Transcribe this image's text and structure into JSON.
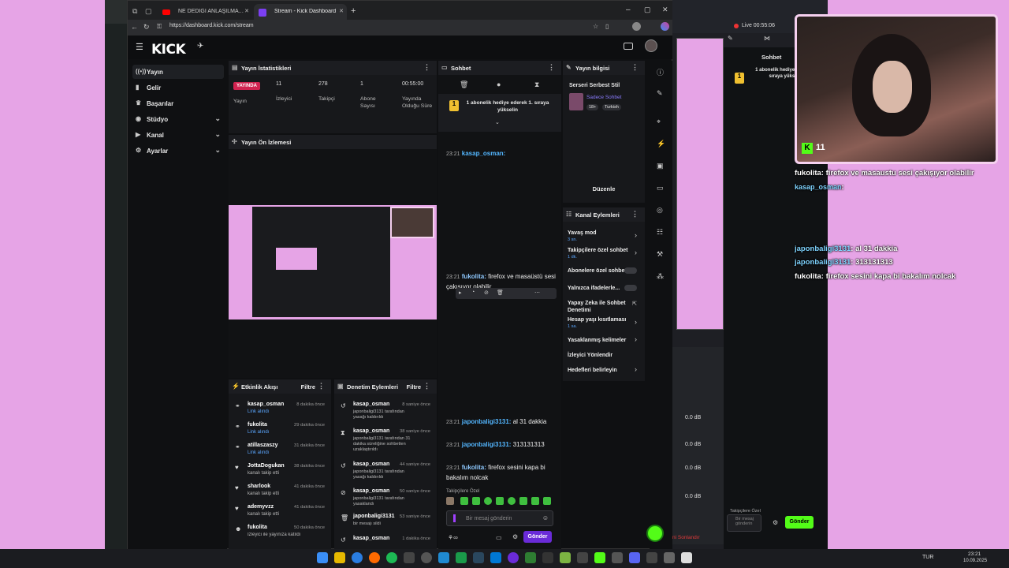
{
  "browser": {
    "tabs": [
      {
        "label": "NE DEDİĞİ ANLAŞILMAYAN KADI"
      },
      {
        "label": "Stream - Kick Dashboard"
      }
    ],
    "url": "https://dashboard.kick.com/stream"
  },
  "kick": {
    "logo": "KICK",
    "nav": [
      {
        "label": "Yayın",
        "icon": "broadcast-icon"
      },
      {
        "label": "Gelir",
        "icon": "revenue-icon"
      },
      {
        "label": "Başarılar",
        "icon": "trophy-icon"
      },
      {
        "label": "Stüdyo",
        "icon": "studio-icon"
      },
      {
        "label": "Kanal",
        "icon": "channel-icon"
      },
      {
        "label": "Ayarlar",
        "icon": "settings-icon"
      }
    ],
    "stats": {
      "title": "Yayın İstatistikleri",
      "live_badge": "YAYINDA",
      "live_label": "Yayın",
      "viewers": "11",
      "viewers_label": "İzleyici",
      "followers": "278",
      "followers_label": "Takipçi",
      "subs": "1",
      "subs_label": "Abone Sayısı",
      "duration": "00:55:00",
      "duration_label": "Yayında Olduğu Süre"
    },
    "preview": {
      "title": "Yayın Ön İzlemesi"
    },
    "activity": {
      "title": "Etkinlik Akışı",
      "filter": "Filtre",
      "items": [
        {
          "name": "kasap_osman",
          "sub": "Link alındı",
          "time": "8 dakika önce"
        },
        {
          "name": "fukolita",
          "sub": "Link alındı",
          "time": "29 dakika önce"
        },
        {
          "name": "atillaszaszy",
          "sub": "Link alındı",
          "time": "31 dakika önce"
        },
        {
          "name": "JottaDogukan",
          "sub": "kanalı takip etti",
          "time": "38 dakika önce"
        },
        {
          "name": "sharlook",
          "sub": "kanalı takip etti",
          "time": "41 dakika önce"
        },
        {
          "name": "ademyvzz",
          "sub": "kanalı takip etti",
          "time": "41 dakika önce"
        },
        {
          "name": "fukolita",
          "sub": "İzleyici ile yayınıza katıldı",
          "time": "50 dakika önce"
        }
      ]
    },
    "moderation": {
      "title": "Denetim Eylemleri",
      "filter": "Filtre",
      "items": [
        {
          "name": "kasap_osman",
          "time": "8 saniye önce",
          "line1": "japonbaligi3131 tarafından yasağı kaldırıldı"
        },
        {
          "name": "kasap_osman",
          "time": "38 saniye önce",
          "line1": "japonbaligi3131 tarafından 31 dakika süreliğine sohbetten uzaklaştırıldı"
        },
        {
          "name": "kasap_osman",
          "time": "44 saniye önce",
          "line1": "japonbaligi3131 tarafından yasağı kaldırıldı"
        },
        {
          "name": "kasap_osman",
          "time": "50 saniye önce",
          "line1": "japonbaligi3131 tarafından yasaklandı"
        },
        {
          "name": "japonbaligi3131",
          "time": "53 saniye önce",
          "line1": "bir mesajı sildi"
        },
        {
          "name": "kasap_osman",
          "time": "1 dakika önce",
          "line1": ""
        }
      ]
    },
    "chat": {
      "title": "Sohbet",
      "pinned": "1 abonelik hediye ederek 1. sıraya yükselin",
      "messages": [
        {
          "time": "23:21",
          "user": "kasap_osman:",
          "text": ""
        },
        {
          "time": "23:21",
          "user": "fukolita:",
          "text": "firefox ve masaüstü sesi çakışıyor olabilir"
        },
        {
          "time": "23:21",
          "user": "japonbaligi3131:",
          "text": "al 31 dakkia"
        },
        {
          "time": "23:21",
          "user": "japonbaligi3131:",
          "text": "313131313"
        },
        {
          "time": "23:21",
          "user": "fukolita:",
          "text": "firefox sesini kapa bi bakalım nolcak"
        }
      ],
      "emote_label": "Takipçilere Özel",
      "input_placeholder": "Bir mesaj gönderin",
      "send": "Gönder"
    },
    "streaminfo": {
      "title": "Yayın bilgisi",
      "stream_title": "Serseri Serbest Stil",
      "category": "Sadece Sohbet",
      "tags": [
        "18+",
        "Turkish"
      ],
      "edit": "Düzenle"
    },
    "channel_actions": {
      "title": "Kanal Eylemleri",
      "items": [
        {
          "label": "Yavaş mod",
          "sub": "3 sn.",
          "type": "arrow"
        },
        {
          "label": "Takipçilere özel sohbet",
          "sub": "1 dk.",
          "type": "arrow"
        },
        {
          "label": "Abonelere özel sohbet",
          "sub": "",
          "type": "toggle"
        },
        {
          "label": "Yalnızca ifadelerle...",
          "sub": "",
          "type": "toggle"
        },
        {
          "label": "Yapay Zeka ile Sohbet Denetimi",
          "sub": "",
          "type": "link"
        },
        {
          "label": "Hesap yaşı kısıtlaması",
          "sub": "1 sa.",
          "type": "arrow"
        },
        {
          "label": "Yasaklanmış kelimeler",
          "sub": "",
          "type": "arrow"
        },
        {
          "label": "İzleyici Yönlendir",
          "sub": "",
          "type": "none"
        },
        {
          "label": "Hedefleri belirleyin",
          "sub": "",
          "type": "arrow"
        }
      ]
    }
  },
  "obs": {
    "live": "Live 00:55:06",
    "chat_title": "Sohbet",
    "pinned": "1 abonelik hediye ederek 1. sıraya yükselin",
    "db_values": [
      "0.0 dB",
      "0.0 dB",
      "0.0 dB",
      "0.0 dB"
    ],
    "end_button": "ni Sonlandır",
    "emote_label": "Takipçilere Özel",
    "placeholder": "Bir mesaj gönderin",
    "send": "Gönder"
  },
  "overlay": {
    "cam_viewers": "11",
    "lines": [
      {
        "user": "fukolita",
        "text": ": firefox ve masaustu sesi çakışıyor olabilir"
      },
      {
        "user": "kasap_osman",
        "text": ":"
      },
      {
        "user": "japonbaligi3131",
        "text": ": al 31 dakkia"
      },
      {
        "user": "japonbaligi3131",
        "text": ": 313131313"
      },
      {
        "user": "fukolita",
        "text": ": firefox sesini kapa bi bakalım nolcak"
      }
    ]
  },
  "taskbar": {
    "lang": "TUR",
    "time": "23:21",
    "date": "10.09.2025"
  },
  "colors": {
    "kick_green": "#53fc18",
    "live_red": "#d12350",
    "accent_purple": "#6a2bd8"
  }
}
